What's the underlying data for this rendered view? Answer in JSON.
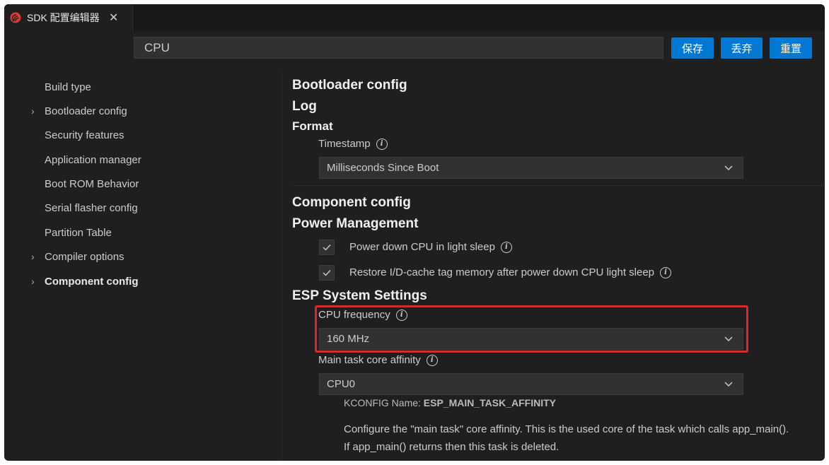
{
  "tab": {
    "title": "SDK 配置编辑器",
    "close_glyph": "✕",
    "logo_icon": "espressif-logo-icon"
  },
  "search": {
    "value": "CPU"
  },
  "toolbar": {
    "save_label": "保存",
    "discard_label": "丢弃",
    "reset_label": "重置"
  },
  "colors": {
    "accent": "#0078d4",
    "highlight": "#e0262b",
    "logo": "#e03a2f"
  },
  "sidebar": {
    "items": [
      {
        "label": "Build type",
        "expandable": false
      },
      {
        "label": "Bootloader config",
        "expandable": true
      },
      {
        "label": "Security features",
        "expandable": false
      },
      {
        "label": "Application manager",
        "expandable": false
      },
      {
        "label": "Boot ROM Behavior",
        "expandable": false
      },
      {
        "label": "Serial flasher config",
        "expandable": false
      },
      {
        "label": "Partition Table",
        "expandable": false
      },
      {
        "label": "Compiler options",
        "expandable": true
      },
      {
        "label": "Component config",
        "expandable": true,
        "active": true
      }
    ]
  },
  "main": {
    "bootloader_heading": "Bootloader config",
    "log_heading": "Log",
    "format_heading": "Format",
    "timestamp_label": "Timestamp",
    "timestamp_value": "Milliseconds Since Boot",
    "component_heading": "Component config",
    "power_heading": "Power Management",
    "check1_label": "Power down CPU in light sleep",
    "check2_label": "Restore I/D-cache tag memory after power down CPU light sleep",
    "esp_heading": "ESP System Settings",
    "cpu_freq_label": "CPU frequency",
    "cpu_freq_value": "160 MHz",
    "affinity_label": "Main task core affinity",
    "affinity_value": "CPU0",
    "kconfig_prefix": "KCONFIG Name:",
    "kconfig_name": "ESP_MAIN_TASK_AFFINITY",
    "desc_line1": "Configure the \"main task\" core affinity. This is the used core of the task which calls app_main().",
    "desc_line2": "If app_main() returns then this task is deleted."
  }
}
